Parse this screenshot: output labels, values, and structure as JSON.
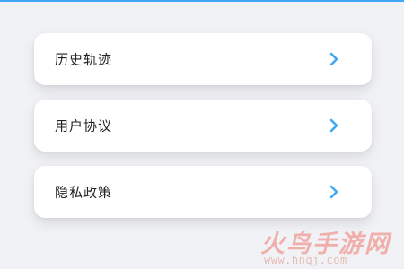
{
  "menu": {
    "items": [
      {
        "label": "历史轨迹",
        "icon": "chevron-right-icon"
      },
      {
        "label": "用户协议",
        "icon": "chevron-right-icon"
      },
      {
        "label": "隐私政策",
        "icon": "chevron-right-icon"
      }
    ]
  },
  "watermark": {
    "title": "火鸟手游网",
    "url": "www.hnqj.com"
  },
  "colors": {
    "background": "#f1f2f6",
    "card": "#ffffff",
    "chevron": "#3fa9f5",
    "text": "#222222"
  }
}
